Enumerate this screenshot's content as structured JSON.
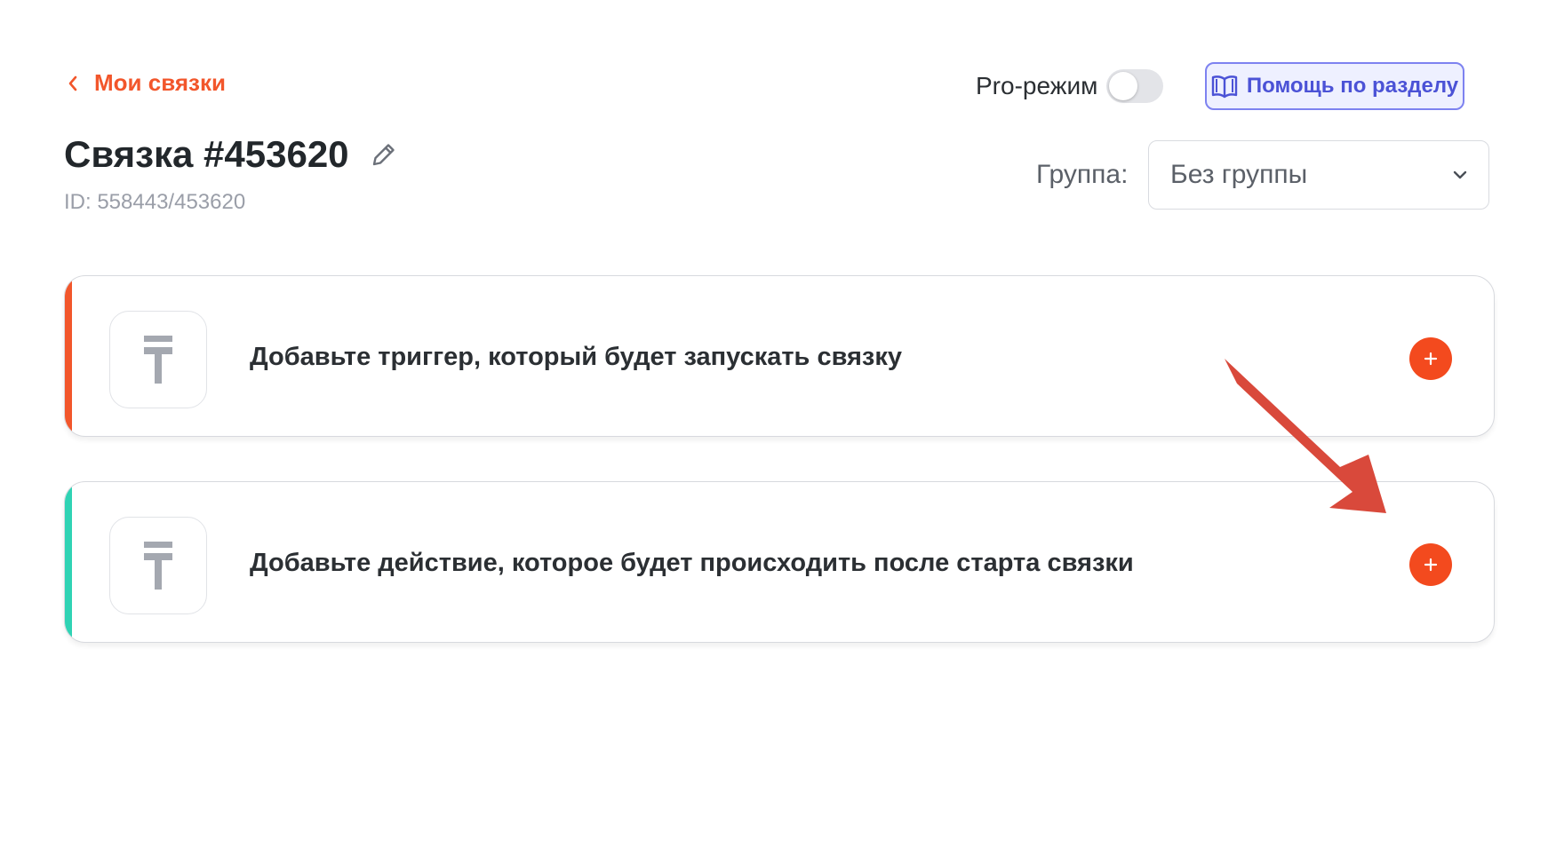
{
  "nav": {
    "back_label": "Мои связки"
  },
  "header": {
    "pro_mode_label": "Pro-режим",
    "pro_mode_enabled": false,
    "help_label": "Помощь по разделу"
  },
  "bundle": {
    "title": "Связка #453620",
    "id_text": "ID: 558443/453620"
  },
  "group": {
    "label": "Группа:",
    "selected": "Без группы"
  },
  "steps": [
    {
      "type": "trigger",
      "text": "Добавьте триггер, который будет запускать связку",
      "accent_color": "#f2562b"
    },
    {
      "type": "action",
      "text": "Добавьте действие, которое будет происходить после старта связки",
      "accent_color": "#2fd3b4"
    }
  ],
  "colors": {
    "brand": "#f2562b",
    "add_button": "#f34a1e",
    "help_accent": "#4b52d6",
    "annotation_arrow": "#d9493b"
  },
  "icons": {
    "back": "chevron-left-icon",
    "help": "book-icon",
    "edit": "pencil-icon",
    "dropdown": "chevron-down-icon",
    "app_placeholder": "app-placeholder-icon",
    "add": "plus-icon"
  }
}
